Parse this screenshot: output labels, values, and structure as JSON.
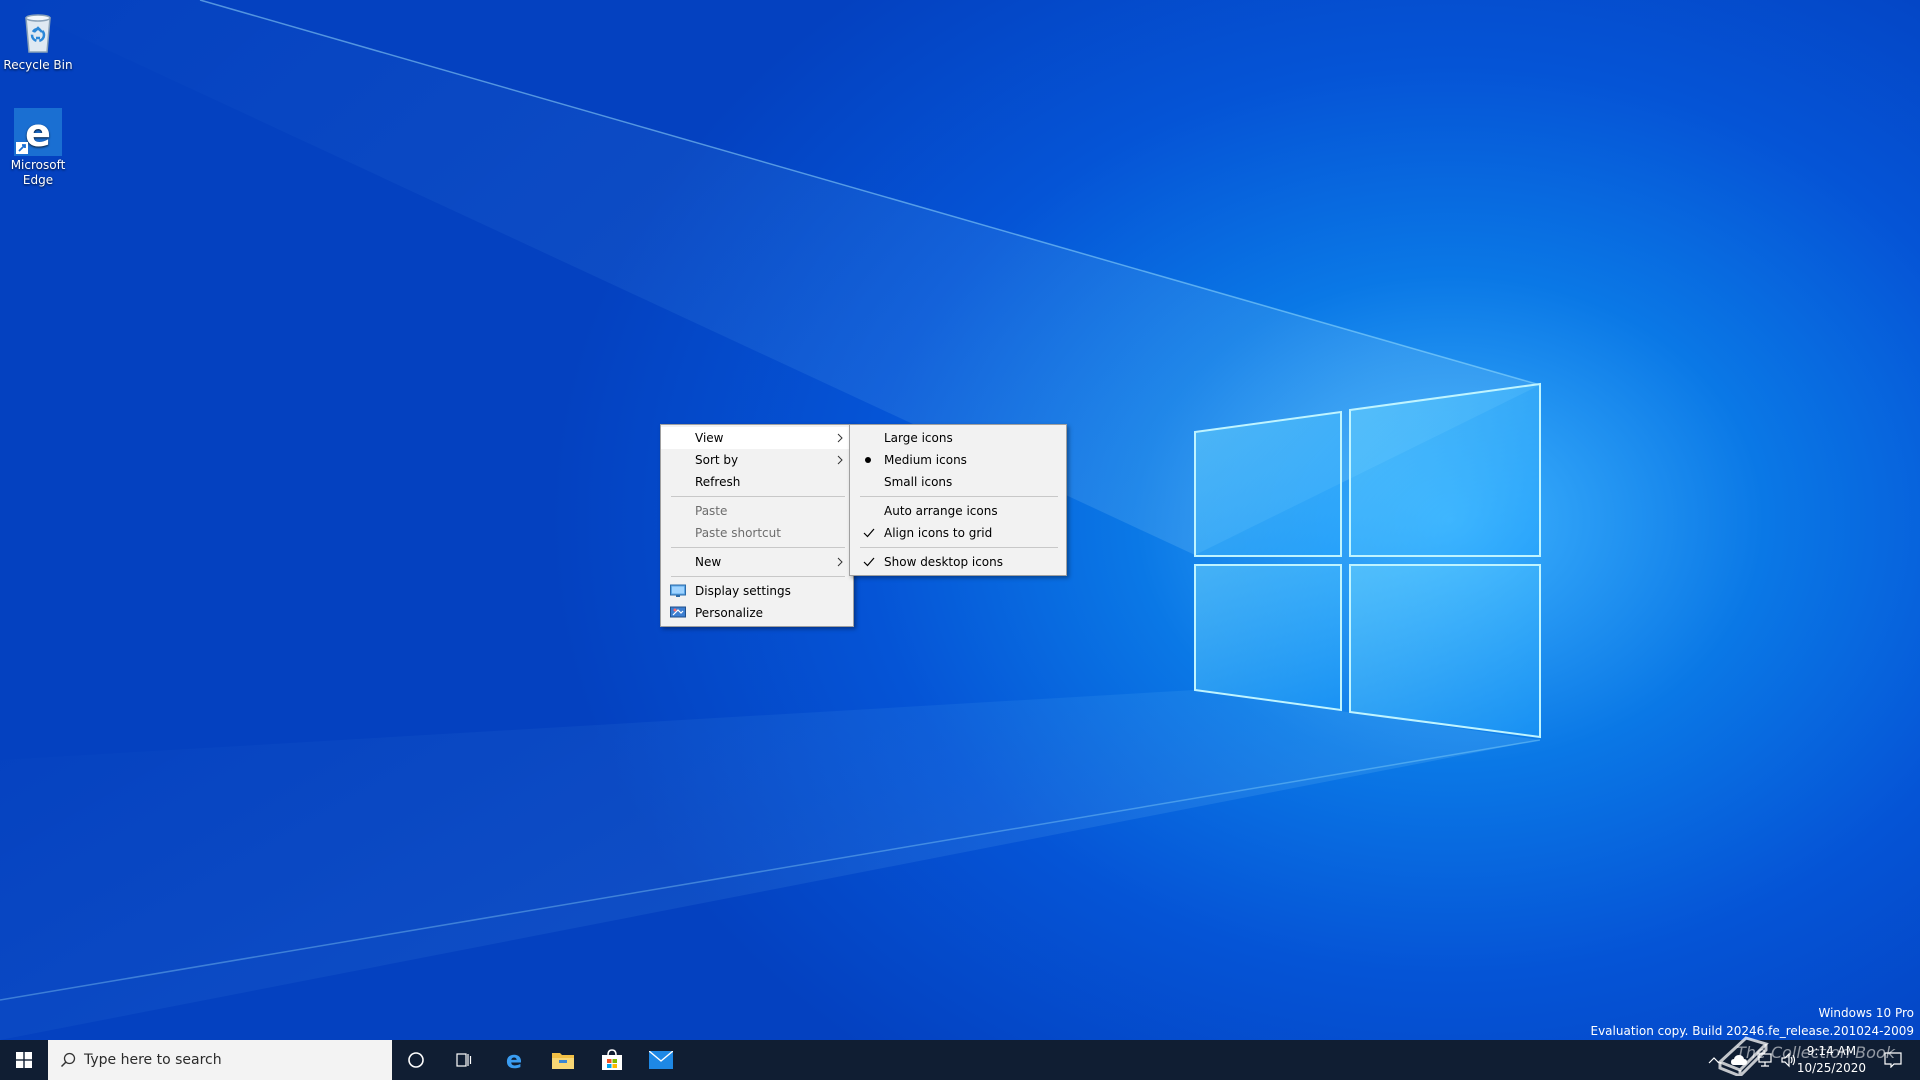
{
  "desktop": {
    "icons": [
      {
        "name": "recycle-bin",
        "label": "Recycle Bin"
      },
      {
        "name": "microsoft-edge",
        "label": "Microsoft Edge"
      }
    ]
  },
  "context_menu": {
    "items": {
      "view": {
        "label": "View",
        "has_submenu": true,
        "highlighted": true
      },
      "sort_by": {
        "label": "Sort by",
        "has_submenu": true
      },
      "refresh": {
        "label": "Refresh"
      },
      "paste": {
        "label": "Paste",
        "disabled": true
      },
      "paste_shortcut": {
        "label": "Paste shortcut",
        "disabled": true
      },
      "new": {
        "label": "New",
        "has_submenu": true
      },
      "display_settings": {
        "label": "Display settings",
        "icon": "display-icon"
      },
      "personalize": {
        "label": "Personalize",
        "icon": "personalize-icon"
      }
    }
  },
  "view_submenu": {
    "items": {
      "large_icons": {
        "label": "Large icons"
      },
      "medium_icons": {
        "label": "Medium icons",
        "selected": true
      },
      "small_icons": {
        "label": "Small icons"
      },
      "auto_arrange": {
        "label": "Auto arrange icons"
      },
      "align_grid": {
        "label": "Align icons to grid",
        "checked": true
      },
      "show_desktop_icons": {
        "label": "Show desktop icons",
        "checked": true
      }
    }
  },
  "watermark": {
    "edition": "Windows 10 Pro",
    "build": "Evaluation copy. Build 20246.fe_release.201024-2009"
  },
  "taskbar": {
    "search_placeholder": "Type here to search",
    "pinned": [
      "cortana-icon",
      "task-view-icon",
      "edge-icon",
      "file-explorer-icon",
      "store-icon",
      "mail-icon"
    ],
    "clock": {
      "time": "9:14 AM",
      "date": "10/25/2020"
    },
    "brand_overlay": "The Collection Book"
  },
  "colors": {
    "taskbar": "#101e33",
    "menu_bg": "#f2f2f2",
    "accent": "#0078d7"
  }
}
